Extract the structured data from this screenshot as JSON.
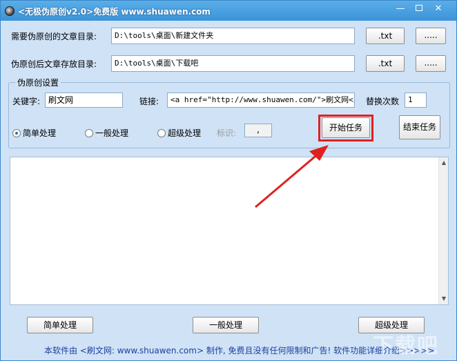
{
  "window": {
    "title": "<无极伪原创v2.0>免费版 www.shuawen.com"
  },
  "source_dir": {
    "label": "需要伪原创的文章目录:",
    "value": "D:\\tools\\桌面\\新建文件夹",
    "ext": ".txt",
    "browse": "....."
  },
  "target_dir": {
    "label": "伪原创后文章存放目录:",
    "value": "D:\\tools\\桌面\\下载吧",
    "ext": ".txt",
    "browse": "....."
  },
  "settings": {
    "group_title": "伪原创设置",
    "keyword_label": "关键字:",
    "keyword_value": "刷文网",
    "link_label": "链接:",
    "link_value": "<a href=\"http://www.shuawen.com/\">刷文网</a>",
    "replace_label": "替换次数",
    "replace_value": "1",
    "radios": [
      {
        "label": "简单处理",
        "checked": true
      },
      {
        "label": "一般处理",
        "checked": false
      },
      {
        "label": "超级处理",
        "checked": false
      }
    ],
    "marker_label": "标识:",
    "marker_value": ",",
    "start_button": "开始任务",
    "stop_button": "结束任务"
  },
  "bottom_buttons": {
    "simple": "简单处理",
    "normal": "一般处理",
    "super": "超级处理"
  },
  "footer": "本软件由 <刷文网: www.shuawen.com> 制作, 免费且没有任何限制和广告! 软件功能详细介绍>>>>>",
  "watermark": "下载吧",
  "colors": {
    "highlight": "#e0201e",
    "titlebar": "#3a92d8",
    "footer_text": "#1d3f9c"
  }
}
